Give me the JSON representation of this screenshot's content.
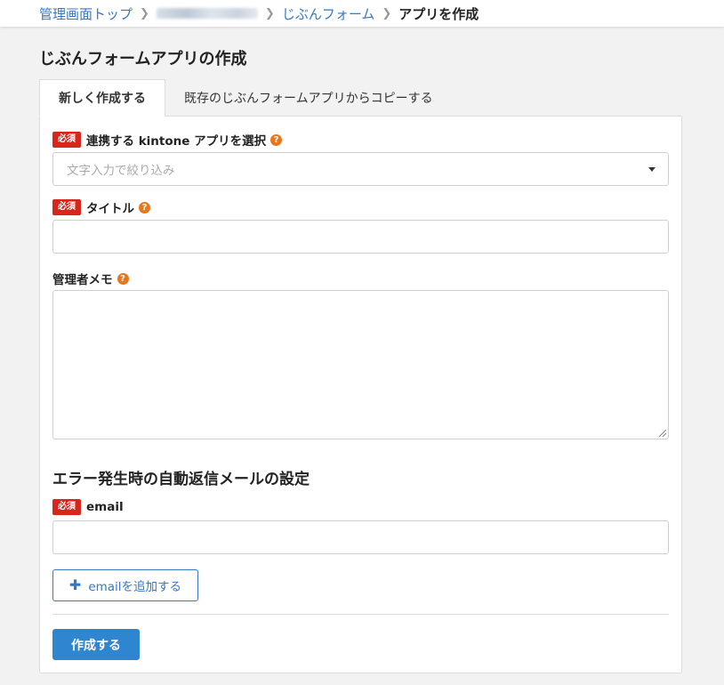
{
  "breadcrumb": {
    "items": [
      "管理画面トップ",
      "じぶんフォーム"
    ],
    "current": "アプリを作成"
  },
  "page_title": "じぶんフォームアプリの作成",
  "tabs": [
    "新しく作成する",
    "既存のじぶんフォームアプリからコピーする"
  ],
  "required_badge": "必須",
  "help_glyph": "?",
  "form": {
    "kintone_app": {
      "label": "連携する kintone アプリを選択",
      "placeholder": "文字入力で絞り込み"
    },
    "title": {
      "label": "タイトル",
      "value": ""
    },
    "admin_memo": {
      "label": "管理者メモ",
      "value": ""
    },
    "error_section_title": "エラー発生時の自動返信メールの設定",
    "email": {
      "label": "email",
      "value": ""
    },
    "add_email_label": "emailを追加する",
    "submit_label": "作成する"
  },
  "colors": {
    "link": "#3478c6",
    "required": "#d9261c",
    "help": "#e8761a",
    "primary_button": "#2e86d0"
  },
  "icons": {
    "breadcrumb_separator": "chevron-right-icon",
    "help": "question-circle-icon",
    "add": "plus-icon",
    "dropdown": "caret-down-icon"
  }
}
